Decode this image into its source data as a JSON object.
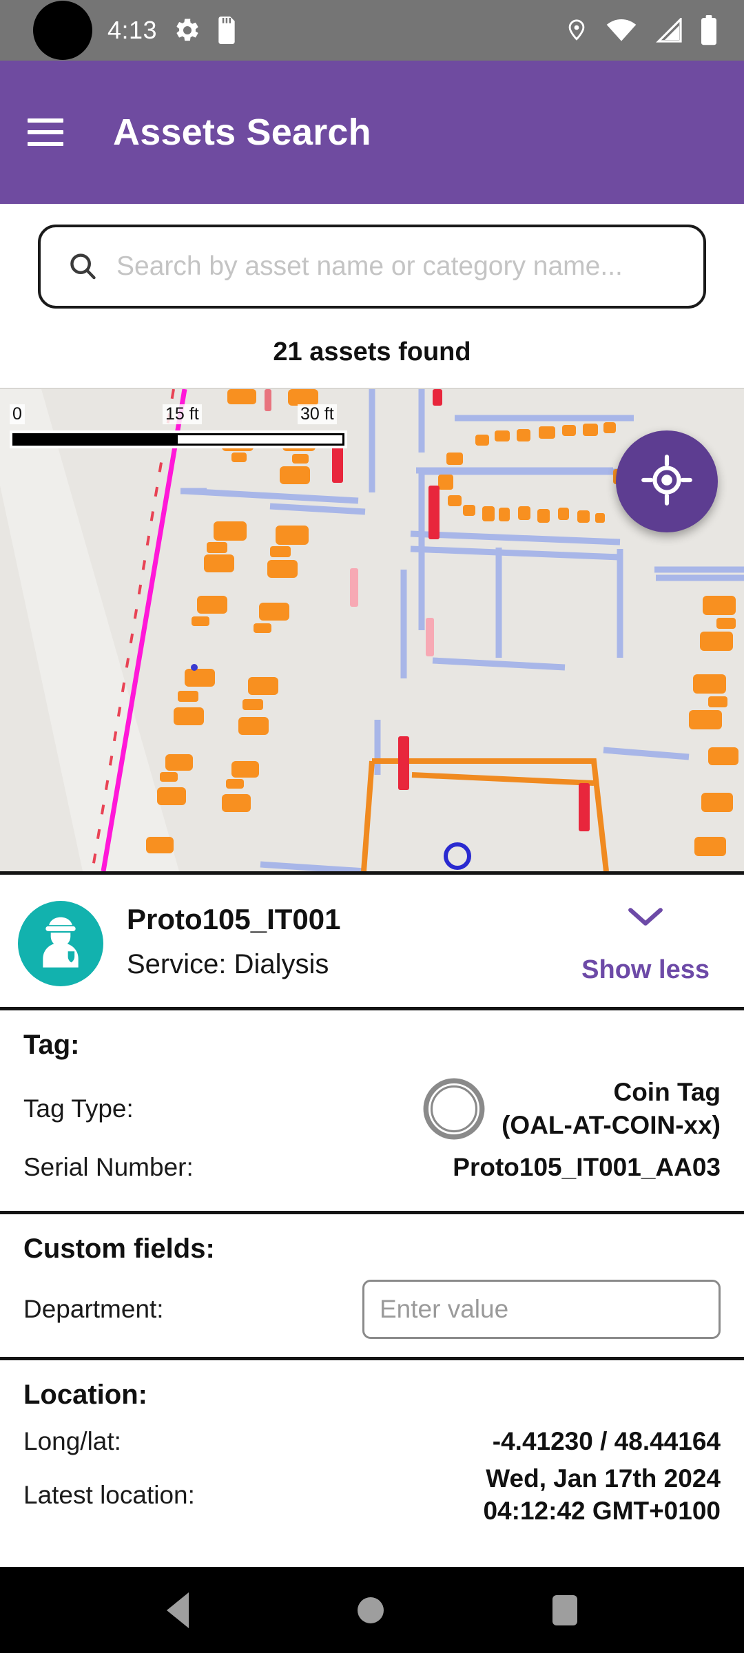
{
  "status_bar": {
    "time": "4:13",
    "icons_left": [
      "gear-icon",
      "sd-card-icon"
    ],
    "icons_right": [
      "location-pin-icon",
      "wifi-icon",
      "signal-icon",
      "battery-icon"
    ]
  },
  "app_bar": {
    "menu_icon": "hamburger-menu-icon",
    "title": "Assets Search"
  },
  "search": {
    "icon": "search-icon",
    "value": "",
    "placeholder": "Search by asset name or category name..."
  },
  "results": {
    "count_label": "21 assets found"
  },
  "map": {
    "scale": {
      "start": "0",
      "middle": "15 ft",
      "end": "30 ft"
    },
    "locate_button": {
      "icon": "my-location-icon",
      "color": "#5d3d91"
    },
    "background_color": "#e8e6e2",
    "asset_marker_color": "#f89020",
    "wall_color": "#a8b6e8",
    "label_color": "#e8263c",
    "path_color": "#ff18d8",
    "building_outline_color": "#f08a20"
  },
  "asset": {
    "avatar_icon": "person-officer-icon",
    "avatar_color": "#12b2ae",
    "name": "Proto105_IT001",
    "service": "Service: Dialysis",
    "toggle": {
      "icon": "chevron-down-icon",
      "label": "Show less",
      "color": "#6d4aa7"
    }
  },
  "tag_section": {
    "title": "Tag:",
    "type_label": "Tag Type:",
    "type_icon": "coin-tag-icon",
    "type_value_line1": "Coin Tag",
    "type_value_line2": "(OAL-AT-COIN-xx)",
    "serial_label": "Serial Number:",
    "serial_value": "Proto105_IT001_AA03"
  },
  "custom_fields_section": {
    "title": "Custom fields:",
    "department_label": "Department:",
    "department_value": "",
    "department_placeholder": "Enter value"
  },
  "location_section": {
    "title": "Location:",
    "longlat_label": "Long/lat:",
    "longlat_value": "-4.41230 / 48.44164",
    "latest_label": "Latest location:",
    "latest_value_line1": "Wed, Jan 17th 2024",
    "latest_value_line2": "04:12:42 GMT+0100"
  },
  "nav_bar": {
    "back": "back-button",
    "home": "home-button",
    "recents": "recents-button"
  }
}
